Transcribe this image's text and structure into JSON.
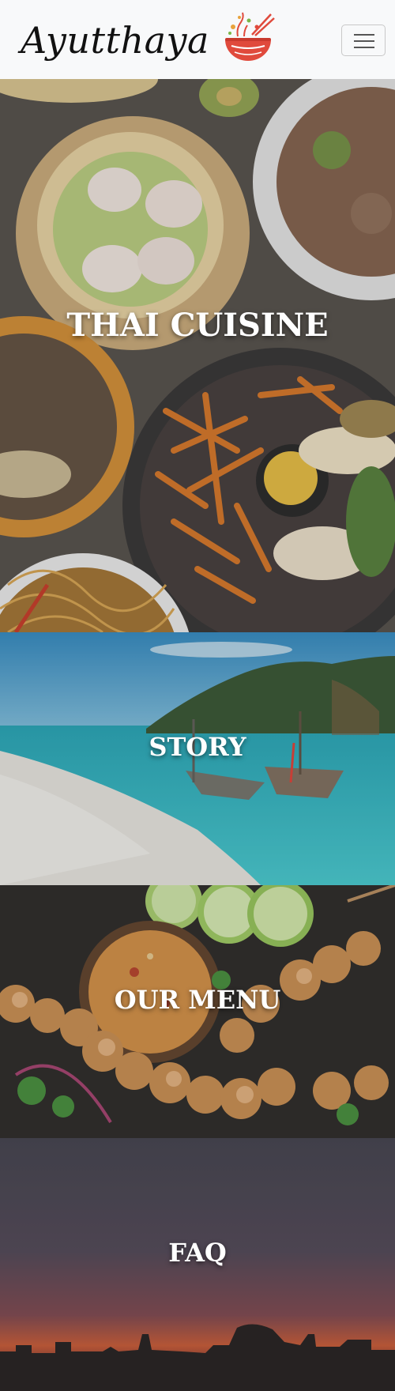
{
  "brand": {
    "name": "Ayutthaya",
    "logo_icon": "noodle-bowl-icon"
  },
  "nav": {
    "toggle_icon": "hamburger-menu-icon"
  },
  "sections": [
    {
      "title": "THAI CUISINE",
      "image": "thai-food-spread-image"
    },
    {
      "title": "STORY",
      "image": "beach-longtail-boats-image"
    },
    {
      "title": "OUR MENU",
      "image": "satay-skewers-image"
    },
    {
      "title": "FAQ",
      "image": "sunset-city-skyline-image"
    }
  ],
  "colors": {
    "navbar_bg": "#f8f9fa",
    "logo_red": "#e04a3c",
    "heading_text": "#ffffff"
  }
}
